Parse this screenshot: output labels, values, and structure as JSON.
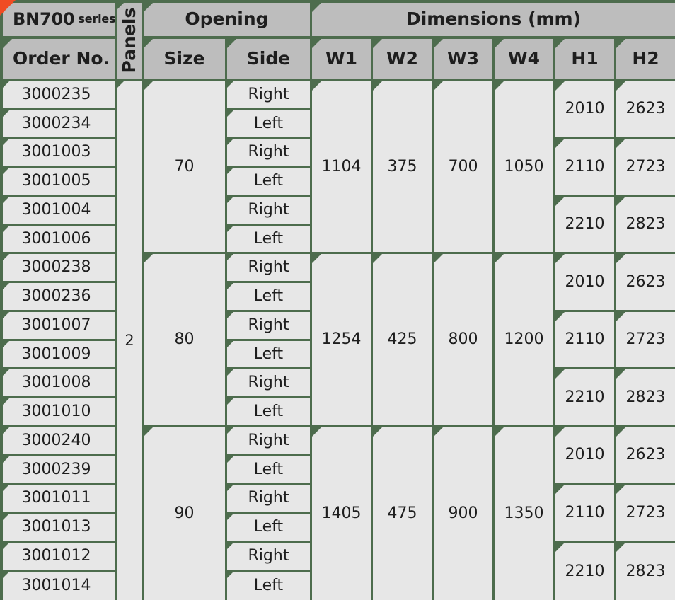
{
  "meta": {
    "bg_color": "#4d6c4d",
    "header_cell_color": "#bdbdbd",
    "body_cell_color": "#e7e7e7",
    "accent_color": "#f04c23",
    "text_color": "#1e1e1e"
  },
  "header": {
    "brand": "BN700",
    "brand_suffix": "series",
    "group_opening": "Opening",
    "group_dimensions": "Dimensions (mm)",
    "col_order_no": "Order No.",
    "col_panels": "Panels",
    "col_size": "Size",
    "col_side": "Side",
    "col_w1": "W1",
    "col_w2": "W2",
    "col_w3": "W3",
    "col_w4": "W4",
    "col_h1": "H1",
    "col_h2": "H2"
  },
  "panels_value": "2",
  "chart_data": {
    "type": "table",
    "title": "BN700 series",
    "columns": [
      "Order No.",
      "Panels",
      "Size",
      "Side",
      "W1",
      "W2",
      "W3",
      "W4",
      "H1",
      "H2"
    ],
    "column_groups": [
      {
        "label": "Opening",
        "columns": [
          "Size",
          "Side"
        ]
      },
      {
        "label": "Dimensions (mm)",
        "columns": [
          "W1",
          "W2",
          "W3",
          "W4",
          "H1",
          "H2"
        ]
      }
    ],
    "rows": [
      [
        "3000235",
        "2",
        "70",
        "Right",
        "1104",
        "375",
        "700",
        "1050",
        "2010",
        "2623"
      ],
      [
        "3000234",
        "2",
        "70",
        "Left",
        "1104",
        "375",
        "700",
        "1050",
        "2010",
        "2623"
      ],
      [
        "3001003",
        "2",
        "70",
        "Right",
        "1104",
        "375",
        "700",
        "1050",
        "2110",
        "2723"
      ],
      [
        "3001005",
        "2",
        "70",
        "Left",
        "1104",
        "375",
        "700",
        "1050",
        "2110",
        "2723"
      ],
      [
        "3001004",
        "2",
        "70",
        "Right",
        "1104",
        "375",
        "700",
        "1050",
        "2210",
        "2823"
      ],
      [
        "3001006",
        "2",
        "70",
        "Left",
        "1104",
        "375",
        "700",
        "1050",
        "2210",
        "2823"
      ],
      [
        "3000238",
        "2",
        "80",
        "Right",
        "1254",
        "425",
        "800",
        "1200",
        "2010",
        "2623"
      ],
      [
        "3000236",
        "2",
        "80",
        "Left",
        "1254",
        "425",
        "800",
        "1200",
        "2010",
        "2623"
      ],
      [
        "3001007",
        "2",
        "80",
        "Right",
        "1254",
        "425",
        "800",
        "1200",
        "2110",
        "2723"
      ],
      [
        "3001009",
        "2",
        "80",
        "Left",
        "1254",
        "425",
        "800",
        "1200",
        "2110",
        "2723"
      ],
      [
        "3001008",
        "2",
        "80",
        "Right",
        "1254",
        "425",
        "800",
        "1200",
        "2210",
        "2823"
      ],
      [
        "3001010",
        "2",
        "80",
        "Left",
        "1254",
        "425",
        "800",
        "1200",
        "2210",
        "2823"
      ],
      [
        "3000240",
        "2",
        "90",
        "Right",
        "1405",
        "475",
        "900",
        "1350",
        "2010",
        "2623"
      ],
      [
        "3000239",
        "2",
        "90",
        "Left",
        "1405",
        "475",
        "900",
        "1350",
        "2010",
        "2623"
      ],
      [
        "3001011",
        "2",
        "90",
        "Right",
        "1405",
        "475",
        "900",
        "1350",
        "2110",
        "2723"
      ],
      [
        "3001013",
        "2",
        "90",
        "Left",
        "1405",
        "475",
        "900",
        "1350",
        "2110",
        "2723"
      ],
      [
        "3001012",
        "2",
        "90",
        "Right",
        "1405",
        "475",
        "900",
        "1350",
        "2210",
        "2823"
      ],
      [
        "3001014",
        "2",
        "90",
        "Left",
        "1405",
        "475",
        "900",
        "1350",
        "2210",
        "2823"
      ]
    ]
  },
  "order_numbers": [
    "3000235",
    "3000234",
    "3001003",
    "3001005",
    "3001004",
    "3001006",
    "3000238",
    "3000236",
    "3001007",
    "3001009",
    "3001008",
    "3001010",
    "3000240",
    "3000239",
    "3001011",
    "3001013",
    "3001012",
    "3001014"
  ],
  "sides": [
    "Right",
    "Left",
    "Right",
    "Left",
    "Right",
    "Left",
    "Right",
    "Left",
    "Right",
    "Left",
    "Right",
    "Left",
    "Right",
    "Left",
    "Right",
    "Left",
    "Right",
    "Left"
  ],
  "groups": [
    {
      "size": "70",
      "w1": "1104",
      "w2": "375",
      "w3": "700",
      "w4": "1050",
      "heights": [
        {
          "h1": "2010",
          "h2": "2623"
        },
        {
          "h1": "2110",
          "h2": "2723"
        },
        {
          "h1": "2210",
          "h2": "2823"
        }
      ]
    },
    {
      "size": "80",
      "w1": "1254",
      "w2": "425",
      "w3": "800",
      "w4": "1200",
      "heights": [
        {
          "h1": "2010",
          "h2": "2623"
        },
        {
          "h1": "2110",
          "h2": "2723"
        },
        {
          "h1": "2210",
          "h2": "2823"
        }
      ]
    },
    {
      "size": "90",
      "w1": "1405",
      "w2": "475",
      "w3": "900",
      "w4": "1350",
      "heights": [
        {
          "h1": "2010",
          "h2": "2623"
        },
        {
          "h1": "2110",
          "h2": "2723"
        },
        {
          "h1": "2210",
          "h2": "2823"
        }
      ]
    }
  ]
}
